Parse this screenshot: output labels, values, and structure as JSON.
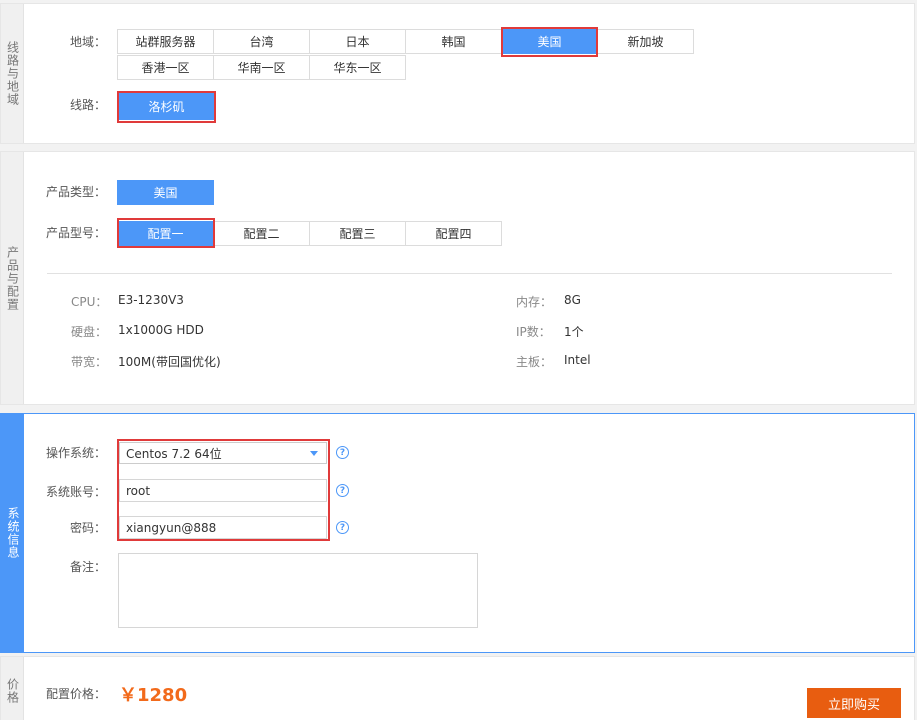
{
  "region_section": {
    "side_label": "线路与地域",
    "region_label": "地域：",
    "regions": [
      "站群服务器",
      "台湾",
      "日本",
      "韩国",
      "美国",
      "新加坡",
      "香港一区",
      "华南一区",
      "华东一区"
    ],
    "selected_region": "美国",
    "line_label": "线路：",
    "lines": [
      "洛杉矶"
    ],
    "selected_line": "洛杉矶"
  },
  "product_section": {
    "side_label": "产品与配置",
    "type_label": "产品类型：",
    "types": [
      "美国"
    ],
    "model_label": "产品型号：",
    "models": [
      "配置一",
      "配置二",
      "配置三",
      "配置四"
    ],
    "selected_model": "配置一",
    "specs": [
      {
        "label": "CPU：",
        "value": "E3-1230V3"
      },
      {
        "label": "内存：",
        "value": "8G"
      },
      {
        "label": "硬盘：",
        "value": "1x1000G HDD"
      },
      {
        "label": "IP数：",
        "value": "1个"
      },
      {
        "label": "带宽：",
        "value": "100M(带回国优化)"
      },
      {
        "label": "主板：",
        "value": "Intel"
      }
    ]
  },
  "system_section": {
    "side_label": "系统信息",
    "os_label": "操作系统：",
    "os_value": "Centos 7.2 64位",
    "account_label": "系统账号：",
    "account_value": "root",
    "password_label": "密码：",
    "password_value": "xiangyun@888",
    "remark_label": "备注：",
    "remark_value": "",
    "help_glyph": "?"
  },
  "price_section": {
    "side_label": "价格",
    "price_label": "配置价格：",
    "price_value": "￥1280",
    "buy_label": "立即购买"
  },
  "colors": {
    "accent": "#4c97f8",
    "highlight": "#e03a3a",
    "price": "#f26a1b",
    "buy": "#e85d10"
  }
}
